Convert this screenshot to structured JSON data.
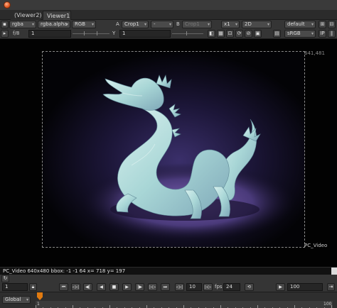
{
  "tabs": [
    {
      "label": "(Viewer2)"
    },
    {
      "label": "Viewer1"
    }
  ],
  "toolbar1": {
    "channels": "rgba",
    "alpha_channel": "rgba.alpha",
    "display_channels": "RGB",
    "input_a_label": "A",
    "input_a_node": "Crop1",
    "input_a_op": "-",
    "input_b_label": "B",
    "input_b_node": "Crop1",
    "zoom": "x1",
    "view_mode": "2D",
    "lut": "default"
  },
  "toolbar2": {
    "fstop": "f/8",
    "frame": "1",
    "y_label": "Y",
    "gamma": "1",
    "colorspace": "sRGB"
  },
  "viewer": {
    "format_size": "641,481",
    "node_name": "PC_Video"
  },
  "info": {
    "text": "PC_Video 640x480  bbox: -1 -1 64  x= 718 y= 197"
  },
  "playback": {
    "frame_field": "1",
    "increment": "10",
    "fps_label": "fps",
    "fps": "24",
    "last_frame": "100",
    "range_mode": "Global"
  },
  "timeline": {
    "tick_labels": [
      "1",
      "",
      "",
      "",
      "",
      "",
      "",
      "",
      "",
      "",
      "",
      "",
      "",
      "",
      "",
      "",
      "",
      "",
      "",
      "",
      "100"
    ]
  },
  "colors": {
    "accent": "#e07a10",
    "background": "#323232",
    "viewer_bg": "#020202"
  }
}
